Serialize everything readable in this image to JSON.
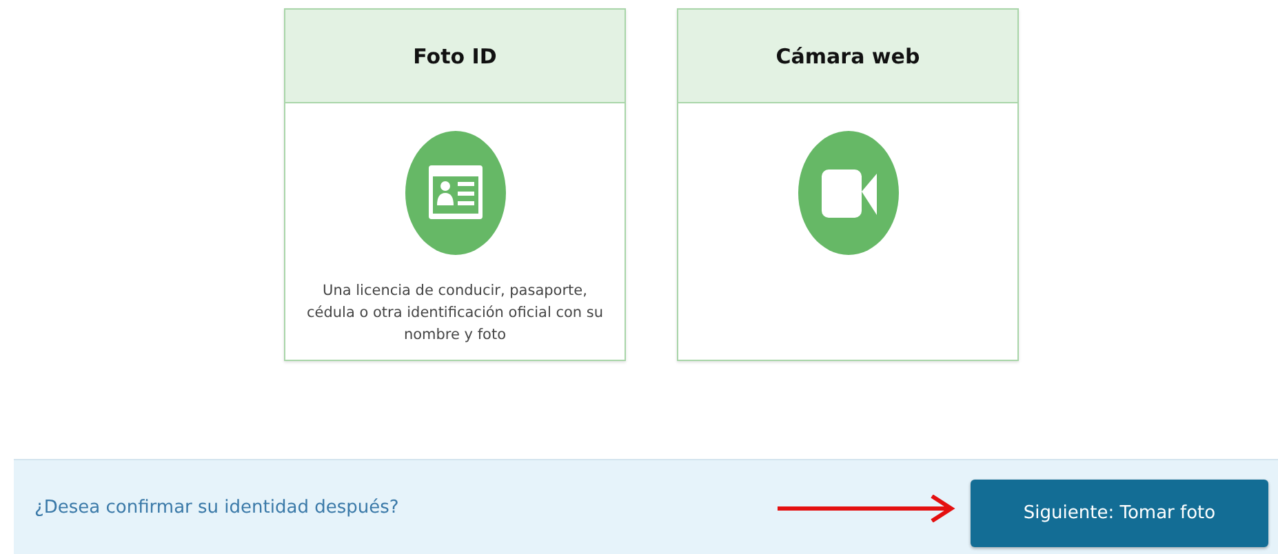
{
  "cards": [
    {
      "kind": "id",
      "title": "Foto ID",
      "description": "Una licencia de conducir, pasaporte, cédula o otra identificación oficial con su nombre y foto"
    },
    {
      "kind": "webcam",
      "title": "Cámara web"
    }
  ],
  "footer": {
    "link": "¿Desea confirmar su identidad después?",
    "button": "Siguiente: Tomar foto"
  }
}
